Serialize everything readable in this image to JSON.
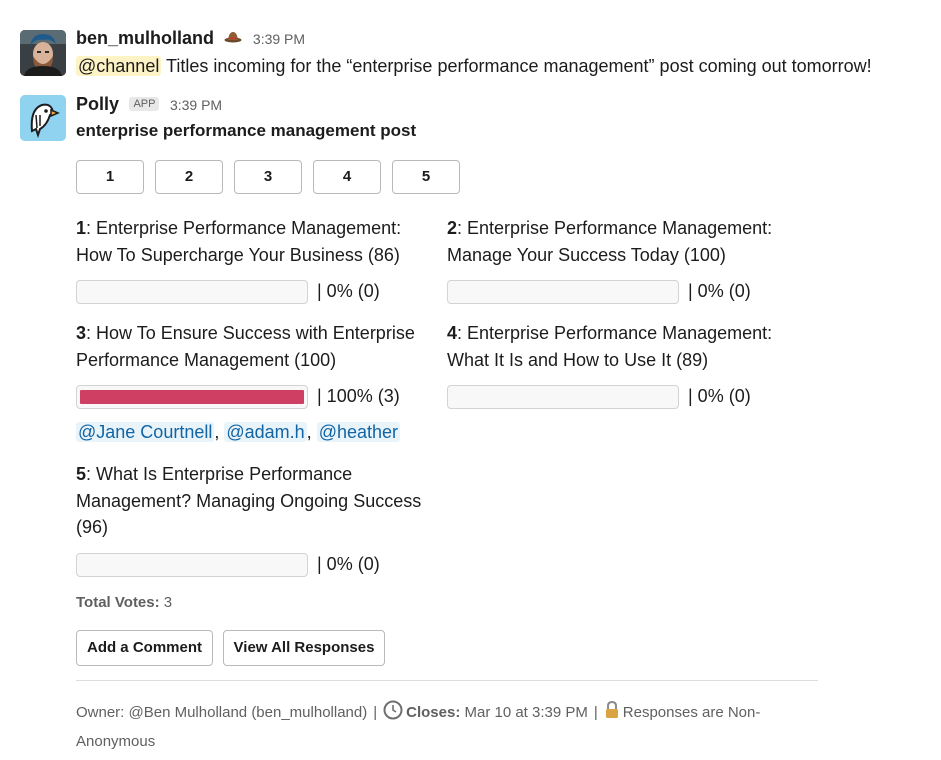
{
  "messages": [
    {
      "author": "ben_mulholland",
      "author_badge_icon": "hat-icon",
      "time": "3:39 PM",
      "mention": "@channel",
      "text": " Titles incoming for the “enterprise performance management” post coming out tomorrow!"
    },
    {
      "author": "Polly",
      "badge": "APP",
      "time": "3:39 PM",
      "title": "enterprise performance management post"
    }
  ],
  "poll": {
    "vote_buttons": [
      "1",
      "2",
      "3",
      "4",
      "5"
    ],
    "options": [
      {
        "num": "1",
        "text": ": Enterprise Performance Management: How To Supercharge Your Business (86)",
        "result": "| 0% (0)",
        "percent": 0
      },
      {
        "num": "2",
        "text": ": Enterprise Performance Management: Manage Your Success Today (100)",
        "result": "| 0% (0)",
        "percent": 0
      },
      {
        "num": "3",
        "text": ": How To Ensure Success with Enterprise Performance Management (100)",
        "result": "| 100% (3)",
        "percent": 100,
        "voters": [
          "@Jane Courtnell",
          "@adam.h",
          "@heather"
        ]
      },
      {
        "num": "4",
        "text": ": Enterprise Performance Management: What It Is and How to Use It (89)",
        "result": "| 0% (0)",
        "percent": 0
      },
      {
        "num": "5",
        "text": ": What Is Enterprise Performance Management? Managing Ongoing Success (96)",
        "result": "| 0% (0)",
        "percent": 0
      }
    ],
    "total_label": "Total Votes:",
    "total_value": " 3",
    "actions": {
      "add_comment": "Add a Comment",
      "view_all": "View All Responses"
    },
    "footer": {
      "owner": "Owner: @Ben Mulholland (ben_mulholland)",
      "sep": "|",
      "closes_label": "Closes:",
      "closes_value": " Mar 10 at 3:39 PM",
      "responses": "Responses are Non-Anonymous"
    }
  },
  "colors": {
    "bar_fill": "#cf3f63",
    "channel_mention_bg": "#fdf3c4",
    "user_mention_bg": "#e8f4fa",
    "user_mention_text": "#1264a3"
  }
}
